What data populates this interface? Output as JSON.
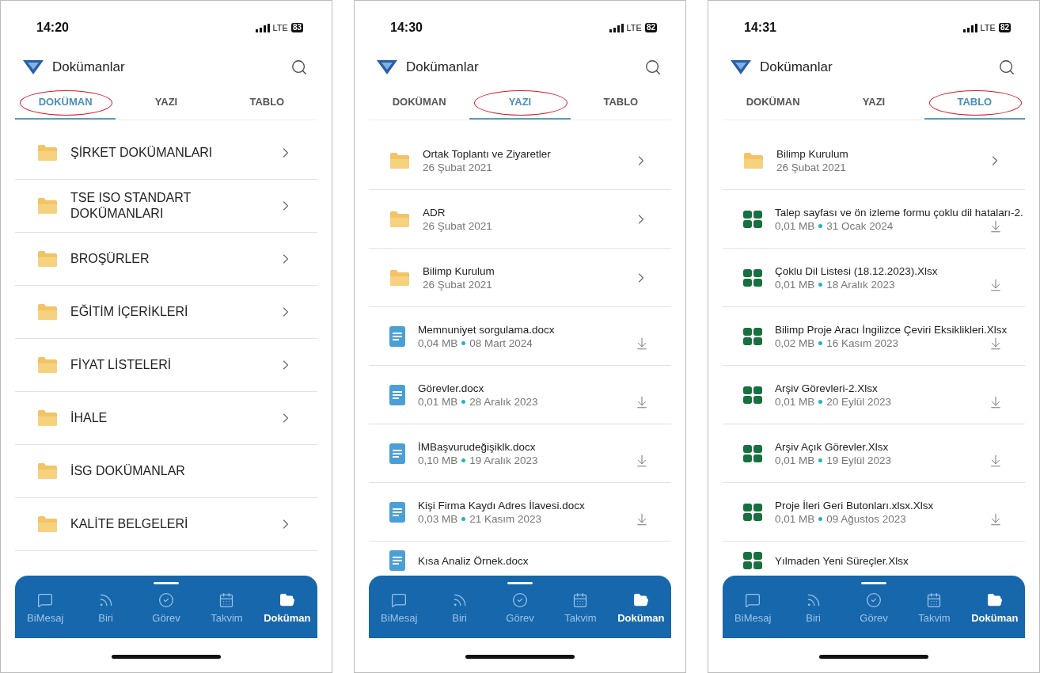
{
  "screens": [
    {
      "status": {
        "time": "14:20",
        "network": "LTE",
        "battery": "83"
      },
      "header": {
        "title": "Dokümanlar"
      },
      "tabs": [
        {
          "label": "DOKÜMAN",
          "selected": true
        },
        {
          "label": "YAZI",
          "selected": false
        },
        {
          "label": "TABLO",
          "selected": false
        }
      ],
      "items": [
        {
          "kind": "folder",
          "name": "ŞİRKET DOKÜMANLARI",
          "chevron": true
        },
        {
          "kind": "folder",
          "name": "TSE ISO STANDART DOKÜMANLARI",
          "chevron": true
        },
        {
          "kind": "folder",
          "name": "BROŞÜRLER",
          "chevron": true
        },
        {
          "kind": "folder",
          "name": "EĞİTİM İÇERİKLERİ",
          "chevron": true
        },
        {
          "kind": "folder",
          "name": "FİYAT LİSTELERİ",
          "chevron": true
        },
        {
          "kind": "folder",
          "name": "İHALE",
          "chevron": true
        },
        {
          "kind": "folder",
          "name": "İSG DOKÜMANLAR",
          "chevron": false
        },
        {
          "kind": "folder",
          "name": "KALİTE BELGELERİ",
          "chevron": true
        }
      ],
      "nav": [
        {
          "label": "BiMesaj",
          "selected": false
        },
        {
          "label": "Biri",
          "selected": false
        },
        {
          "label": "Görev",
          "selected": false
        },
        {
          "label": "Takvim",
          "selected": false
        },
        {
          "label": "Doküman",
          "selected": true
        }
      ]
    },
    {
      "status": {
        "time": "14:30",
        "network": "LTE",
        "battery": "82"
      },
      "header": {
        "title": "Dokümanlar"
      },
      "tabs": [
        {
          "label": "DOKÜMAN",
          "selected": false
        },
        {
          "label": "YAZI",
          "selected": true
        },
        {
          "label": "TABLO",
          "selected": false
        }
      ],
      "items": [
        {
          "kind": "folder",
          "name": "Ortak Toplantı ve Ziyaretler",
          "date": "26 Şubat 2021"
        },
        {
          "kind": "folder",
          "name": "ADR",
          "date": "26 Şubat 2021"
        },
        {
          "kind": "folder",
          "name": "Bilimp Kurulum",
          "date": "26 Şubat 2021"
        },
        {
          "kind": "doc",
          "name": "Memnuniyet sorgulama.docx",
          "size": "0,04 MB",
          "date": "08 Mart 2024"
        },
        {
          "kind": "doc",
          "name": "Görevler.docx",
          "size": "0,01 MB",
          "date": "28 Aralık 2023"
        },
        {
          "kind": "doc",
          "name": "İMBaşvurudeğişiklk.docx",
          "size": "0,10 MB",
          "date": "19 Aralık 2023"
        },
        {
          "kind": "doc",
          "name": "Kişi Firma Kaydı Adres İlavesi.docx",
          "size": "0,03 MB",
          "date": "21 Kasım 2023"
        },
        {
          "kind": "doc",
          "name": "Kısa Analiz Örnek.docx"
        }
      ],
      "nav": [
        {
          "label": "BiMesaj",
          "selected": false
        },
        {
          "label": "Biri",
          "selected": false
        },
        {
          "label": "Görev",
          "selected": false
        },
        {
          "label": "Takvim",
          "selected": false
        },
        {
          "label": "Doküman",
          "selected": true
        }
      ]
    },
    {
      "status": {
        "time": "14:31",
        "network": "LTE",
        "battery": "82"
      },
      "header": {
        "title": "Dokümanlar"
      },
      "tabs": [
        {
          "label": "DOKÜMAN",
          "selected": false
        },
        {
          "label": "YAZI",
          "selected": false
        },
        {
          "label": "TABLO",
          "selected": true
        }
      ],
      "items": [
        {
          "kind": "folder",
          "name": "Bilimp Kurulum",
          "date": "26 Şubat 2021"
        },
        {
          "kind": "sheet",
          "name": "Talep sayfası ve ön izleme formu çoklu dil hataları-2.",
          "size": "0,01 MB",
          "date": "31 Ocak 2024"
        },
        {
          "kind": "sheet",
          "name": "Çoklu Dil Listesi (18.12.2023).Xlsx",
          "size": "0,01 MB",
          "date": "18 Aralık 2023"
        },
        {
          "kind": "sheet",
          "name": "Bilimp Proje Aracı İngilizce Çeviri Eksiklikleri.Xlsx",
          "size": "0,02 MB",
          "date": "16 Kasım 2023"
        },
        {
          "kind": "sheet",
          "name": "Arşiv Görevleri-2.Xlsx",
          "size": "0,01 MB",
          "date": "20 Eylül 2023"
        },
        {
          "kind": "sheet",
          "name": "Arşiv Açık Görevler.Xlsx",
          "size": "0,01 MB",
          "date": "19 Eylül 2023"
        },
        {
          "kind": "sheet",
          "name": "Proje İleri Geri Butonları.xlsx.Xlsx",
          "size": "0,01 MB",
          "date": "09 Ağustos 2023"
        },
        {
          "kind": "sheet",
          "name": "Yılmaden Yeni Süreçler.Xlsx"
        }
      ],
      "nav": [
        {
          "label": "BiMesaj",
          "selected": false
        },
        {
          "label": "Biri",
          "selected": false
        },
        {
          "label": "Görev",
          "selected": false
        },
        {
          "label": "Takvim",
          "selected": false
        },
        {
          "label": "Doküman",
          "selected": true
        }
      ]
    }
  ]
}
